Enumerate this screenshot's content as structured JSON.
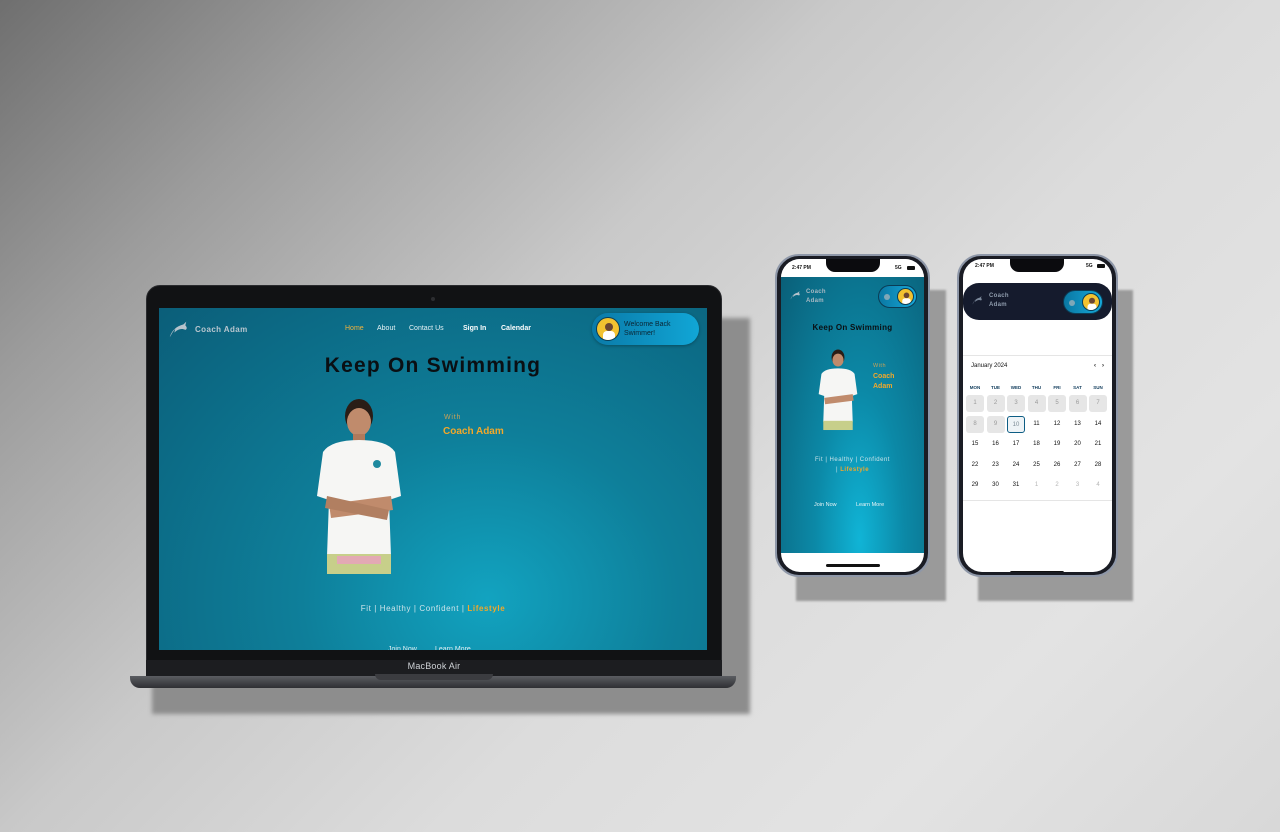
{
  "brand": {
    "name": "Coach Adam",
    "name_line1": "Coach",
    "name_line2": "Adam"
  },
  "nav": {
    "home": "Home",
    "about": "About",
    "contact": "Contact Us",
    "signin": "Sign In",
    "calendar": "Calendar"
  },
  "welcome": "Welcome Back Swimmer!",
  "hero": {
    "title": "Keep On Swimming",
    "with": "With",
    "coach": "Coach Adam",
    "coach_line1": "Coach",
    "coach_line2": "Adam",
    "tagline_prefix": "Fit | Healthy | Confident |",
    "tagline_highlight": "Lifestyle",
    "tagline_mobile_line1": "Fit | Healthy | Confident",
    "tagline_mobile_line2": "Lifestyle"
  },
  "cta": {
    "join": "Join Now",
    "learn": "Learn More"
  },
  "device_label": "MacBook Air",
  "status_bar": {
    "time": "2:47 PM",
    "network": "5G"
  },
  "calendar": {
    "month": "January 2024",
    "prev": "‹",
    "next": "›",
    "weekdays": [
      "MON",
      "TUE",
      "WED",
      "THU",
      "FRI",
      "SAT",
      "SUN"
    ],
    "days": [
      "1",
      "2",
      "3",
      "4",
      "5",
      "6",
      "7",
      "8",
      "9",
      "10",
      "11",
      "12",
      "13",
      "14",
      "15",
      "16",
      "17",
      "18",
      "19",
      "20",
      "21",
      "22",
      "23",
      "24",
      "25",
      "26",
      "27",
      "28",
      "29",
      "30",
      "31",
      "1",
      "2",
      "3",
      "4"
    ],
    "today": "10"
  },
  "colors": {
    "accent_gold": "#f2a82a",
    "teal": "#0e7f9a",
    "navy": "#151b2d"
  }
}
